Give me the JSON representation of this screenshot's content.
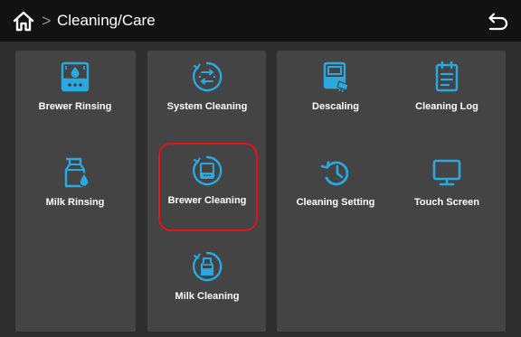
{
  "header": {
    "separator": ">",
    "title": "Cleaning/Care",
    "home_icon": "home-icon",
    "back_icon": "back-arrow-icon"
  },
  "colors": {
    "accent": "#29a9e0",
    "highlight": "#e0151b",
    "topbar": "#121212",
    "panel": "#444444"
  },
  "panels": {
    "left": [
      {
        "label": "Brewer Rinsing",
        "icon": "brewer-rinsing-icon"
      },
      {
        "label": "Milk Rinsing",
        "icon": "milk-rinsing-icon"
      }
    ],
    "middle": [
      {
        "label": "System Cleaning",
        "icon": "system-cleaning-icon"
      },
      {
        "label": "Brewer Cleaning",
        "icon": "brewer-cleaning-icon",
        "selected": true
      },
      {
        "label": "Milk Cleaning",
        "icon": "milk-cleaning-icon"
      }
    ],
    "right": [
      {
        "label": "Descaling",
        "icon": "descaling-icon"
      },
      {
        "label": "Cleaning Log",
        "icon": "cleaning-log-icon"
      },
      {
        "label": "Cleaning Setting",
        "icon": "cleaning-setting-icon"
      },
      {
        "label": "Touch Screen",
        "icon": "touch-screen-icon"
      }
    ]
  }
}
